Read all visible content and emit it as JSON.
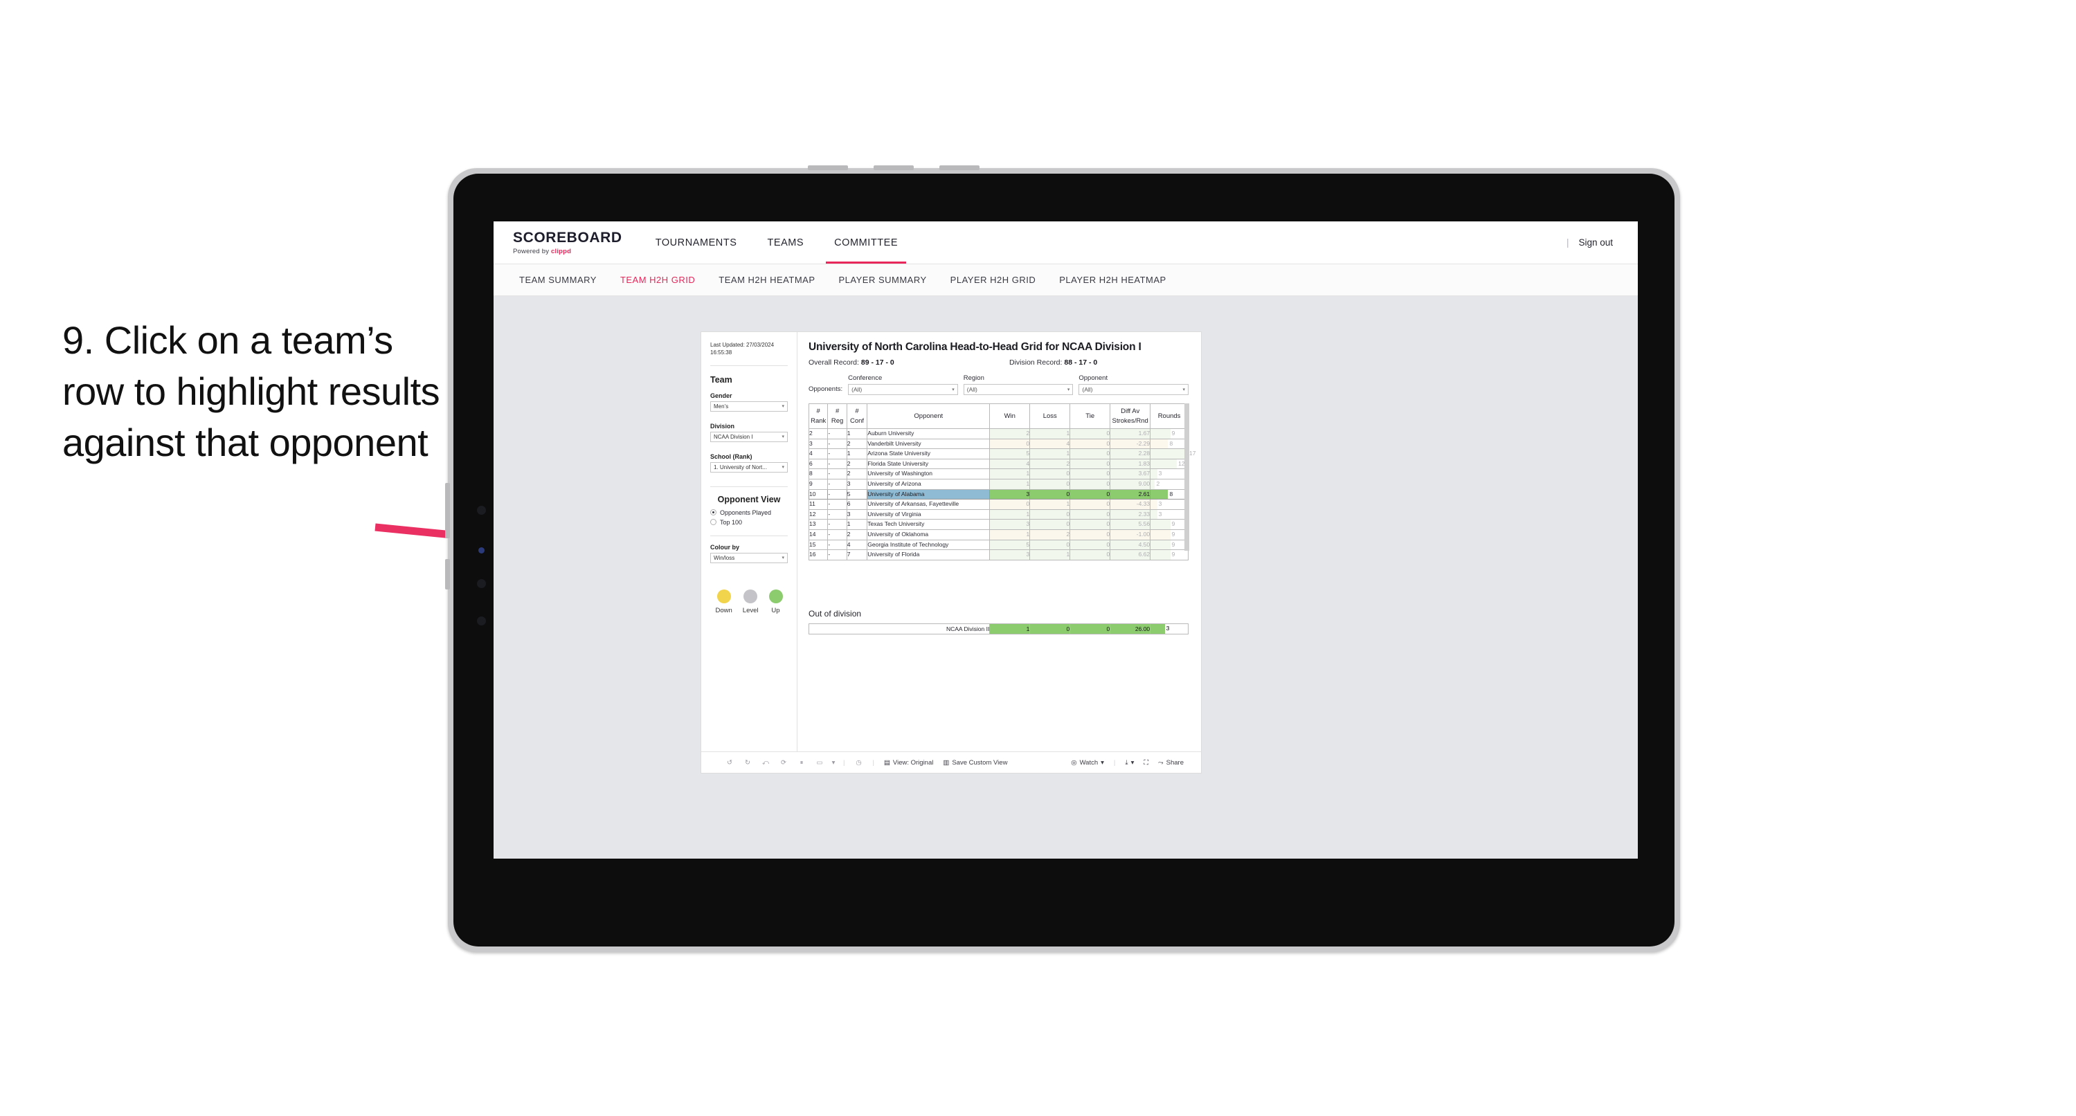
{
  "instruction": "9. Click on a team’s row to highlight results against that opponent",
  "colors": {
    "accent": "#e8275a",
    "win_green": "#8ccb6e",
    "win_green_pale": "#dfecd5",
    "loss_tan_pale": "#f7ecd2",
    "selected_blue": "#8fbcd4",
    "legend_down": "#f2d44c",
    "legend_level": "#c4c4c8",
    "legend_up": "#8ccb6e"
  },
  "topnav": {
    "brand_title": "SCOREBOARD",
    "brand_sub_prefix": "Powered by ",
    "brand_sub_accent": "clippd",
    "items": [
      {
        "label": "TOURNAMENTS",
        "active": false
      },
      {
        "label": "TEAMS",
        "active": false
      },
      {
        "label": "COMMITTEE",
        "active": true
      }
    ],
    "separator": "|",
    "signout": "Sign out"
  },
  "subnav": {
    "items": [
      {
        "label": "TEAM SUMMARY",
        "active": false
      },
      {
        "label": "TEAM H2H GRID",
        "active": true
      },
      {
        "label": "TEAM H2H HEATMAP",
        "active": false
      },
      {
        "label": "PLAYER SUMMARY",
        "active": false
      },
      {
        "label": "PLAYER H2H GRID",
        "active": false
      },
      {
        "label": "PLAYER H2H HEATMAP",
        "active": false
      }
    ]
  },
  "filters": {
    "last_updated_line1": "Last Updated: 27/03/2024",
    "last_updated_line2": "16:55:38",
    "team_heading": "Team",
    "gender_label": "Gender",
    "gender_value": "Men’s",
    "division_label": "Division",
    "division_value": "NCAA Division I",
    "school_label": "School (Rank)",
    "school_value": "1. University of Nort...",
    "opponent_view_heading": "Opponent View",
    "radio_opponents_played": "Opponents Played",
    "radio_top_100": "Top 100",
    "colour_by_label": "Colour by",
    "colour_by_value": "Win/loss",
    "legend": [
      {
        "caption": "Down",
        "color": "#f2d44c"
      },
      {
        "caption": "Level",
        "color": "#c4c4c8"
      },
      {
        "caption": "Up",
        "color": "#8ccb6e"
      }
    ]
  },
  "main": {
    "title": "University of North Carolina Head-to-Head Grid for NCAA Division I",
    "overall_record_label": "Overall Record:",
    "overall_record_value": "89 - 17 - 0",
    "division_record_label": "Division Record:",
    "division_record_value": "88 - 17 - 0",
    "opponents_label": "Opponents:",
    "opponent_filters": [
      {
        "label": "Conference",
        "value": "(All)"
      },
      {
        "label": "Region",
        "value": "(All)"
      },
      {
        "label": "Opponent",
        "value": "(All)"
      }
    ],
    "columns": [
      "# Rank",
      "# Reg",
      "# Conf",
      "Opponent",
      "Win",
      "Loss",
      "Tie",
      "Diff Av Strokes/Rnd",
      "Rounds"
    ],
    "column_heads": {
      "rank_l1": "#",
      "rank_l2": "Rank",
      "reg_l1": "#",
      "reg_l2": "Reg",
      "conf_l1": "#",
      "conf_l2": "Conf",
      "opponent": "Opponent",
      "win": "Win",
      "loss": "Loss",
      "tie": "Tie",
      "diff_l1": "Diff Av",
      "diff_l2": "Strokes/Rnd",
      "rounds": "Rounds"
    },
    "rows": [
      {
        "rank": "2",
        "reg": "-",
        "conf": "1",
        "opponent": "Auburn University",
        "win": "2",
        "loss": "1",
        "tie": "0",
        "diff": "1.67",
        "rounds": "9",
        "result": "up",
        "selected": false
      },
      {
        "rank": "3",
        "reg": "-",
        "conf": "2",
        "opponent": "Vanderbilt University",
        "win": "0",
        "loss": "4",
        "tie": "0",
        "diff": "-2.29",
        "rounds": "8",
        "result": "down",
        "selected": false
      },
      {
        "rank": "4",
        "reg": "-",
        "conf": "1",
        "opponent": "Arizona State University",
        "win": "5",
        "loss": "1",
        "tie": "0",
        "diff": "2.28",
        "rounds": "17",
        "result": "up",
        "selected": false
      },
      {
        "rank": "6",
        "reg": "-",
        "conf": "2",
        "opponent": "Florida State University",
        "win": "4",
        "loss": "2",
        "tie": "0",
        "diff": "1.83",
        "rounds": "12",
        "result": "up",
        "selected": false
      },
      {
        "rank": "8",
        "reg": "-",
        "conf": "2",
        "opponent": "University of Washington",
        "win": "1",
        "loss": "0",
        "tie": "0",
        "diff": "3.67",
        "rounds": "3",
        "result": "up",
        "selected": false
      },
      {
        "rank": "9",
        "reg": "-",
        "conf": "3",
        "opponent": "University of Arizona",
        "win": "1",
        "loss": "0",
        "tie": "0",
        "diff": "9.00",
        "rounds": "2",
        "result": "up",
        "selected": false
      },
      {
        "rank": "10",
        "reg": "-",
        "conf": "5",
        "opponent": "University of Alabama",
        "win": "3",
        "loss": "0",
        "tie": "0",
        "diff": "2.61",
        "rounds": "8",
        "result": "up",
        "selected": true
      },
      {
        "rank": "11",
        "reg": "-",
        "conf": "6",
        "opponent": "University of Arkansas, Fayetteville",
        "win": "0",
        "loss": "1",
        "tie": "0",
        "diff": "-4.33",
        "rounds": "3",
        "result": "down",
        "selected": false
      },
      {
        "rank": "12",
        "reg": "-",
        "conf": "3",
        "opponent": "University of Virginia",
        "win": "1",
        "loss": "0",
        "tie": "0",
        "diff": "2.33",
        "rounds": "3",
        "result": "up",
        "selected": false
      },
      {
        "rank": "13",
        "reg": "-",
        "conf": "1",
        "opponent": "Texas Tech University",
        "win": "3",
        "loss": "0",
        "tie": "0",
        "diff": "5.56",
        "rounds": "9",
        "result": "up",
        "selected": false
      },
      {
        "rank": "14",
        "reg": "-",
        "conf": "2",
        "opponent": "University of Oklahoma",
        "win": "1",
        "loss": "2",
        "tie": "0",
        "diff": "-1.00",
        "rounds": "9",
        "result": "down",
        "selected": false
      },
      {
        "rank": "15",
        "reg": "-",
        "conf": "4",
        "opponent": "Georgia Institute of Technology",
        "win": "5",
        "loss": "0",
        "tie": "0",
        "diff": "4.50",
        "rounds": "9",
        "result": "up",
        "selected": false
      },
      {
        "rank": "16",
        "reg": "-",
        "conf": "7",
        "opponent": "University of Florida",
        "win": "3",
        "loss": "1",
        "tie": "0",
        "diff": "6.62",
        "rounds": "9",
        "result": "up",
        "selected": false
      }
    ],
    "out_of_division": {
      "title": "Out of division",
      "row": {
        "name": "NCAA Division II",
        "win": "1",
        "loss": "0",
        "tie": "0",
        "diff": "26.00",
        "rounds": "3"
      }
    }
  },
  "toolbar": {
    "view_label": "View: Original",
    "save_label": "Save Custom View",
    "watch_label": "Watch",
    "share_label": "Share",
    "separator": "|",
    "caret": "▾"
  },
  "chart_data": {
    "type": "table",
    "title": "University of North Carolina Head-to-Head Grid for NCAA Division I",
    "columns": [
      "# Rank",
      "# Reg",
      "# Conf",
      "Opponent",
      "Win",
      "Loss",
      "Tie",
      "Diff Av Strokes/Rnd",
      "Rounds"
    ],
    "rows": [
      [
        "2",
        "-",
        "1",
        "Auburn University",
        2,
        1,
        0,
        1.67,
        9
      ],
      [
        "3",
        "-",
        "2",
        "Vanderbilt University",
        0,
        4,
        0,
        -2.29,
        8
      ],
      [
        "4",
        "-",
        "1",
        "Arizona State University",
        5,
        1,
        0,
        2.28,
        17
      ],
      [
        "6",
        "-",
        "2",
        "Florida State University",
        4,
        2,
        0,
        1.83,
        12
      ],
      [
        "8",
        "-",
        "2",
        "University of Washington",
        1,
        0,
        0,
        3.67,
        3
      ],
      [
        "9",
        "-",
        "3",
        "University of Arizona",
        1,
        0,
        0,
        9.0,
        2
      ],
      [
        "10",
        "-",
        "5",
        "University of Alabama",
        3,
        0,
        0,
        2.61,
        8
      ],
      [
        "11",
        "-",
        "6",
        "University of Arkansas, Fayetteville",
        0,
        1,
        0,
        -4.33,
        3
      ],
      [
        "12",
        "-",
        "3",
        "University of Virginia",
        1,
        0,
        0,
        2.33,
        3
      ],
      [
        "13",
        "-",
        "1",
        "Texas Tech University",
        3,
        0,
        0,
        5.56,
        9
      ],
      [
        "14",
        "-",
        "2",
        "University of Oklahoma",
        1,
        2,
        0,
        -1.0,
        9
      ],
      [
        "15",
        "-",
        "4",
        "Georgia Institute of Technology",
        5,
        0,
        0,
        4.5,
        9
      ],
      [
        "16",
        "-",
        "7",
        "University of Florida",
        3,
        1,
        0,
        6.62,
        9
      ]
    ],
    "out_of_division_rows": [
      [
        "NCAA Division II",
        1,
        0,
        0,
        26.0,
        3
      ]
    ],
    "legend": [
      "Down",
      "Level",
      "Up"
    ],
    "selected_row": "University of Alabama",
    "rounds_max": 17
  }
}
